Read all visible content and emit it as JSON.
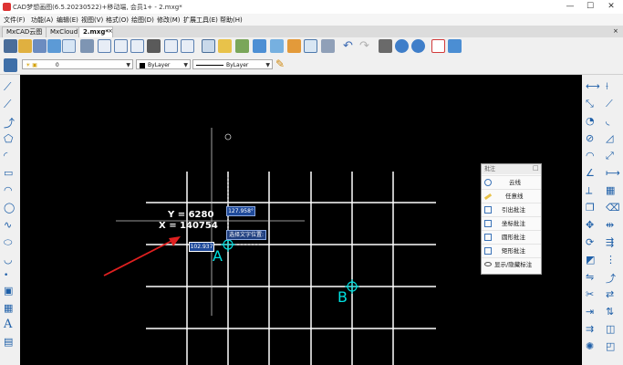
{
  "window": {
    "title": "CAD梦想画图(6.5.20230522)+移动端, 会员1+ - 2.mxg*",
    "minimize": "—",
    "maximize": "☐",
    "close": "✕"
  },
  "menu": [
    "文件(F)",
    "功能(A)",
    "编辑(E)",
    "视图(V)",
    "格式(O)",
    "绘图(D)",
    "修改(M)",
    "扩展工具(E)",
    "帮助(H)"
  ],
  "tabs": [
    {
      "label": "MxCAD云图",
      "active": false
    },
    {
      "label": "MxCloud1",
      "active": false
    },
    {
      "label": "2.mxg*",
      "active": true
    }
  ],
  "props": {
    "layer": "0",
    "color": "ByLayer",
    "linetype": "ByLayer",
    "lineweight": "ByLayer"
  },
  "canvas": {
    "coord_y": "Y = 6280",
    "coord_x": "X = 140754",
    "angle_value": "127.958°",
    "length_value": "102.937",
    "tooltip": "选择文字位置:",
    "point_a": "A",
    "point_b": "B"
  },
  "annotation_panel": {
    "header": "批注",
    "items": [
      {
        "label": "云线",
        "icon": "cloud-icon"
      },
      {
        "label": "任意线",
        "icon": "pencil-icon"
      },
      {
        "label": "引出批注",
        "icon": "leader-icon"
      },
      {
        "label": "坐标批注",
        "icon": "coordinate-icon"
      },
      {
        "label": "圆形批注",
        "icon": "circle-note-icon"
      },
      {
        "label": "矩形批注",
        "icon": "rect-note-icon"
      },
      {
        "label": "显示/隐藏标注",
        "icon": "eye-icon"
      }
    ]
  },
  "colors": {
    "canvas_bg": "#000000",
    "grid": "#ffffff",
    "arrow": "#e02020",
    "point_marker": "#00e0e0",
    "crosshair": "#c8c8c8",
    "input_box": "#1f4a9a"
  }
}
